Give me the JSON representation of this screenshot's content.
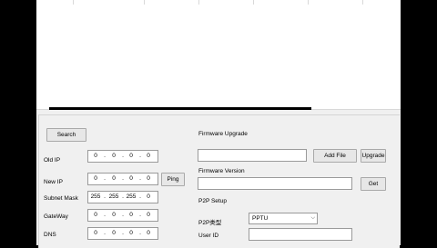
{
  "buttons": {
    "search": "Search",
    "ping": "Ping",
    "add_file": "Add File",
    "upgrade": "Upgrade",
    "get": "Get"
  },
  "network": {
    "old_ip": {
      "label": "Old IP",
      "octets": [
        "0",
        "0",
        "0",
        "0"
      ]
    },
    "new_ip": {
      "label": "New IP",
      "octets": [
        "0",
        "0",
        "0",
        "0"
      ]
    },
    "subnet_mask": {
      "label": "Subnet Mask",
      "octets": [
        "255",
        "255",
        "255",
        "0"
      ]
    },
    "gateway": {
      "label": "GateWay",
      "octets": [
        "0",
        "0",
        "0",
        "0"
      ]
    },
    "dns": {
      "label": "DNS",
      "octets": [
        "0",
        "0",
        "0",
        "0"
      ]
    }
  },
  "firmware": {
    "upgrade_label": "Firmware Upgrade",
    "version_label": "Firmware Version",
    "file_value": "",
    "version_value": ""
  },
  "p2p": {
    "section_label": "P2P Setup",
    "type_label": "P2P类型",
    "type_value": "PPTU",
    "user_id_label": "User ID",
    "user_id_value": ""
  }
}
